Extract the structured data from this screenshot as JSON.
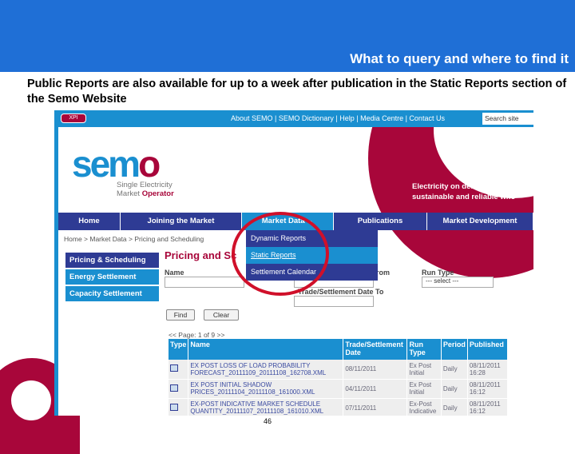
{
  "slide": {
    "title": "What to query and where to find it",
    "subtitle": "Public Reports are also available for up to a week after publication in the Static Reports section of the Semo Website",
    "page_number": "46"
  },
  "site": {
    "xpi": "XPI",
    "top_links": "About SEMO | SEMO Dictionary | Help | Media Centre | Contact Us",
    "search_placeholder": "Search site",
    "logo": {
      "sem": "se",
      "m": "m",
      "o": "o",
      "line1": "Single Electricity",
      "line2a": "Market ",
      "line2b": "Operator"
    },
    "tagline": [
      "Electricity on demand from a",
      "sustainable and reliable who"
    ],
    "nav": [
      "Home",
      "Joining the Market",
      "Market Data  ⌄",
      "Publications",
      "Market Development"
    ],
    "breadcrumb": "Home > Market Data > Pricing and Scheduling",
    "sidebar": [
      "Pricing & Scheduling",
      "Energy Settlement",
      "Capacity Settlement"
    ],
    "heading": "Pricing and Sc",
    "dropdown": [
      "Dynamic Reports",
      "Static Reports",
      "Settlement Calendar"
    ],
    "form": {
      "name": "Name",
      "date_from": "e From",
      "date_to": "Trade/Settlement Date To",
      "run_type": "Run Type",
      "run_type_value": "--- select ---",
      "find": "Find",
      "clear": "Clear"
    },
    "pager": "<< Page: 1 of 9 >>",
    "table": {
      "headers": [
        "Type",
        "Name",
        "Trade/Settlement Date",
        "Run Type",
        "Period",
        "Published"
      ],
      "rows": [
        [
          "EX POST LOSS OF LOAD PROBABILITY FORECAST_20111109_20111108_162708.XML",
          "08/11/2011",
          "Ex Post Initial",
          "Daily",
          "08/11/2011 16:28"
        ],
        [
          "EX POST INITIAL SHADOW PRICES_20111104_20111108_161000.XML",
          "04/11/2011",
          "Ex Post Initial",
          "Daily",
          "08/11/2011 16:12"
        ],
        [
          "EX-POST INDICATIVE MARKET SCHEDULE QUANTITY_20111107_20111108_161010.XML",
          "07/11/2011",
          "Ex-Post Indicative",
          "Daily",
          "08/11/2011 16:12"
        ]
      ]
    }
  },
  "colors": {
    "slide_blue": "#1f6fd6",
    "maroon": "#a8063a",
    "site_blue": "#1a8fd0",
    "nav_blue": "#2e3b94",
    "highlight_circle": "#d0102a"
  }
}
